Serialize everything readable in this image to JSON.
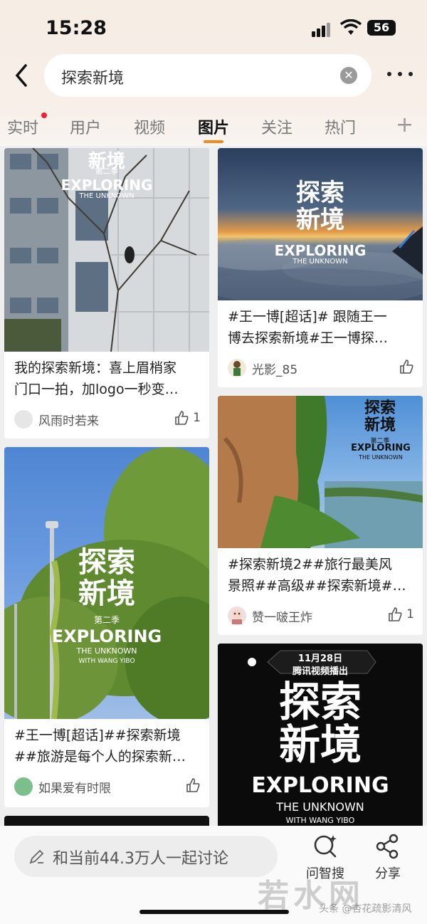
{
  "status": {
    "time": "15:28",
    "battery": "56"
  },
  "search": {
    "query": "探索新境"
  },
  "tabs": [
    {
      "label": "实时"
    },
    {
      "label": "用户"
    },
    {
      "label": "视频"
    },
    {
      "label": "图片"
    },
    {
      "label": "关注"
    },
    {
      "label": "热门"
    }
  ],
  "posts": [
    {
      "caption1": "我的探索新境：喜上眉梢家",
      "caption2": "门口一拍，加logo一秒变…",
      "user": "风雨时若来",
      "likes": "1"
    },
    {
      "caption1": "#王一博[超话]#  跟随王一",
      "caption2": "博去探索新境#王一博探…",
      "user": "光影_85",
      "likes": ""
    },
    {
      "caption1": "#王一博[超话]##探索新境",
      "caption2": "##旅游是每个人的探索新…",
      "user": "如果爱有时限",
      "likes": ""
    },
    {
      "caption1": "#探索新境2##旅行最美风",
      "caption2": "景照##高级##探索新境#…",
      "user": "赞一啵王炸",
      "likes": "1"
    }
  ],
  "poster": {
    "title_line1": "探索",
    "title_line2": "新境",
    "season": "第二季",
    "en_title": "EXPLORING",
    "en_sub": "THE UNKNOWN",
    "with": "WITH WANG YIBO",
    "broadcast_date": "11月28日",
    "broadcast_platform": "腾讯视频播出"
  },
  "bottom": {
    "discuss_placeholder": "和当前44.3万人一起讨论",
    "ask_label": "问智搜",
    "share_label": "分享"
  },
  "watermark": {
    "text": "若水网",
    "sub": "头条 @杏花疏影清风"
  }
}
